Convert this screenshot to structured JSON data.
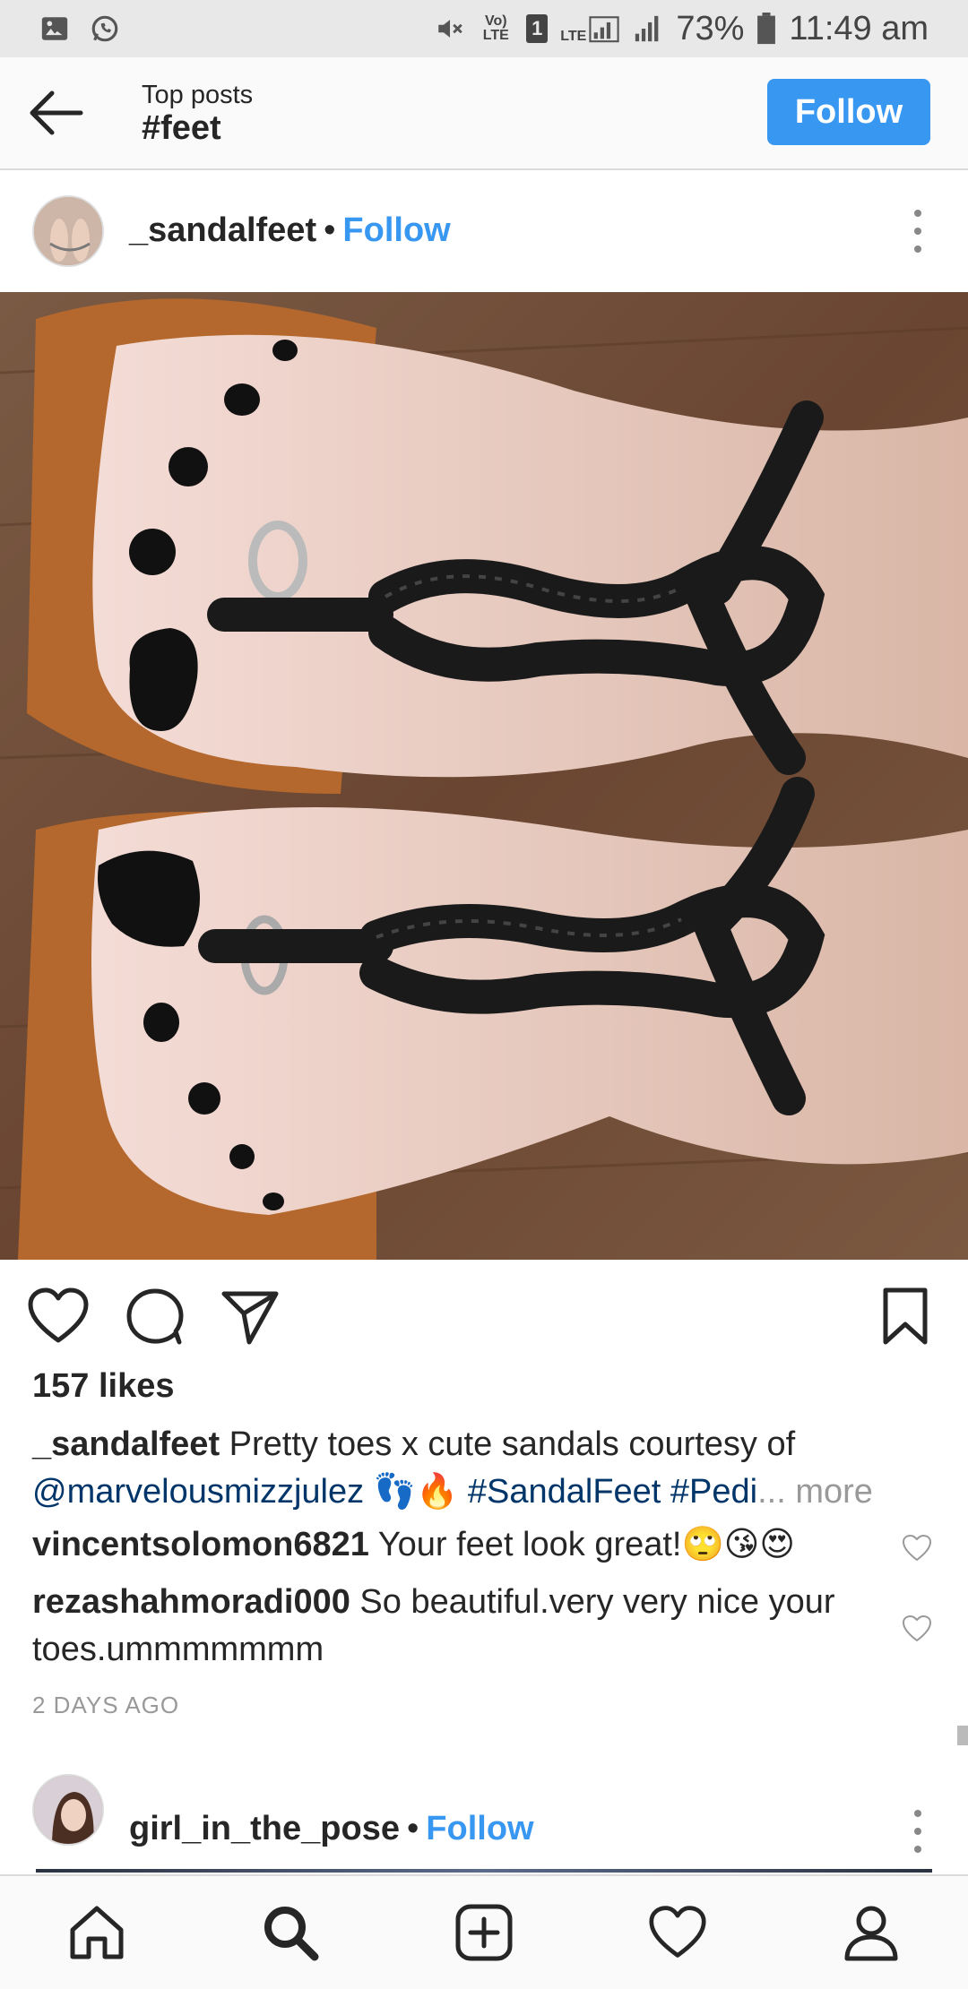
{
  "status_bar": {
    "left_icons": [
      "image-icon",
      "whatsapp-icon"
    ],
    "right_icons": [
      "mute-icon",
      "volte-icon",
      "sim-1-icon",
      "lte-signal-icon",
      "signal-icon",
      "battery-icon"
    ],
    "volte_label": "Vo) LTE",
    "sim_label": "1",
    "lte_label": "LTE",
    "battery_percent": "73%",
    "time": "11:49 am"
  },
  "header": {
    "subtitle": "Top posts",
    "title": "#feet",
    "follow_label": "Follow"
  },
  "post": {
    "username": "_sandalfeet",
    "separator": "•",
    "follow_label": "Follow",
    "likes": "157 likes",
    "caption": {
      "username": "_sandalfeet",
      "text": " Pretty toes x cute sandals courtesy of ",
      "mention": "@marvelousmizzjulez",
      "emojis": " 👣🔥 ",
      "hashtags": "#SandalFeet #Pedi",
      "more": "... more"
    },
    "comments": [
      {
        "username": "vincentsolomon6821",
        "text": " Your feet look great!🙄😘😍"
      },
      {
        "username": "rezashahmoradi000",
        "text": " So beautiful.very very nice your toes.ummmmmmm"
      }
    ],
    "timestamp": "2 DAYS AGO"
  },
  "next_post": {
    "username": "girl_in_the_pose",
    "separator": "•",
    "follow_label": "Follow"
  },
  "bottom_nav": [
    "home-icon",
    "search-icon",
    "add-post-icon",
    "activity-heart-icon",
    "profile-icon"
  ],
  "colors": {
    "accent": "#3897f0",
    "mention": "#003569",
    "muted": "#999999",
    "text": "#262626"
  }
}
